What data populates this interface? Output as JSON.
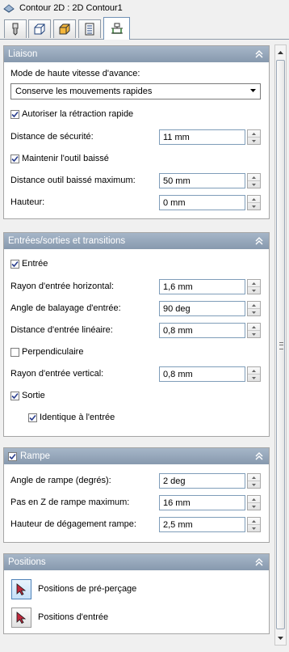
{
  "window": {
    "title": "Contour 2D : 2D Contour1"
  },
  "tabs": [
    {
      "icon": "tool-icon"
    },
    {
      "icon": "geometry-icon"
    },
    {
      "icon": "heights-icon"
    },
    {
      "icon": "passes-icon"
    },
    {
      "icon": "linking-icon",
      "active": true
    }
  ],
  "liaison": {
    "title": "Liaison",
    "high_feed_label": "Mode de haute vitesse d'avance:",
    "high_feed_value": "Conserve les mouvements rapides",
    "allow_retract_label": "Autoriser la rétraction rapide",
    "allow_retract_checked": true,
    "safe_distance_label": "Distance de sécurité:",
    "safe_distance_value": "11 mm",
    "keep_down_label": "Maintenir l'outil baissé",
    "keep_down_checked": true,
    "keep_down_distance_label": "Distance outil baissé maximum:",
    "keep_down_distance_value": "50 mm",
    "height_label": "Hauteur:",
    "height_value": "0 mm"
  },
  "leads": {
    "title": "Entrées/sorties et transitions",
    "entry_label": "Entrée",
    "entry_checked": true,
    "horiz_radius_label": "Rayon d'entrée horizontal:",
    "horiz_radius_value": "1,6 mm",
    "sweep_angle_label": "Angle de balayage d'entrée:",
    "sweep_angle_value": "90 deg",
    "linear_distance_label": "Distance d'entrée linéaire:",
    "linear_distance_value": "0,8 mm",
    "perpendicular_label": "Perpendiculaire",
    "perpendicular_checked": false,
    "vert_radius_label": "Rayon d'entrée vertical:",
    "vert_radius_value": "0,8 mm",
    "exit_label": "Sortie",
    "exit_checked": true,
    "same_as_entry_label": "Identique à l'entrée",
    "same_as_entry_checked": true
  },
  "ramp": {
    "title": "Rampe",
    "checked": true,
    "angle_label": "Angle de rampe (degrés):",
    "angle_value": "2 deg",
    "max_stepdown_label": "Pas en Z de rampe maximum:",
    "max_stepdown_value": "16 mm",
    "clearance_label": "Hauteur de dégagement rampe:",
    "clearance_value": "2,5 mm"
  },
  "positions": {
    "title": "Positions",
    "predrill_label": "Positions de pré-perçage",
    "entry_positions_label": "Positions d'entrée"
  },
  "colors": {
    "header_gradient_top": "#a6b6c8",
    "header_gradient_bottom": "#8799ae",
    "input_border": "#7f9db9",
    "pointer_red": "#c0283c"
  }
}
